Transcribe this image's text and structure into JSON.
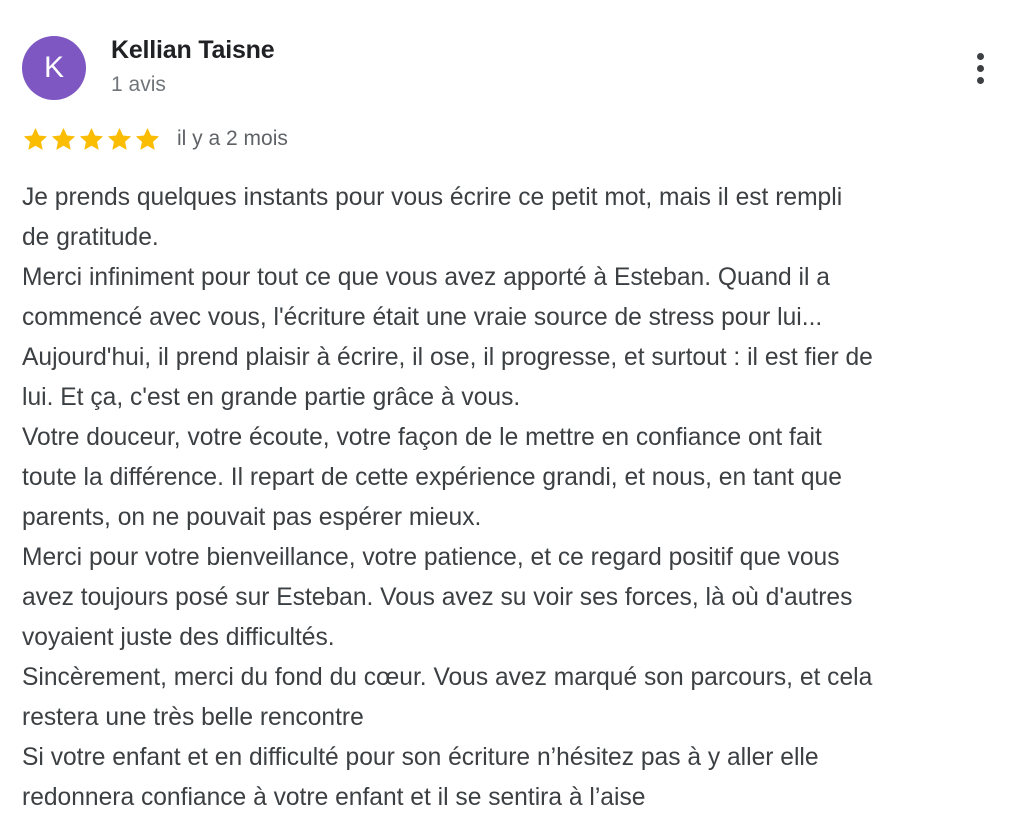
{
  "author": {
    "initial": "K",
    "name": "Kellian Taisne",
    "meta": "1 avis",
    "avatar_color": "#7e57c2"
  },
  "rating": {
    "stars": 5,
    "max": 5,
    "star_color": "#fbbc04",
    "time": "il y a 2 mois"
  },
  "menu_icon": "more-vert-icon",
  "review_lines": [
    "Je prends quelques instants pour vous écrire ce petit mot, mais il est rempli",
    "de gratitude.",
    "Merci infiniment pour tout ce que vous avez apporté à Esteban. Quand il a",
    "commencé avec vous, l'écriture était une vraie source de stress pour lui...",
    "Aujourd'hui, il prend plaisir à écrire, il ose, il progresse, et surtout : il est fier de",
    "lui. Et ça, c'est en grande partie grâce à vous.",
    "Votre douceur, votre écoute, votre façon de le mettre en confiance ont fait",
    "toute la différence. Il repart de cette expérience grandi, et nous, en tant que",
    "parents, on ne pouvait pas espérer mieux.",
    "Merci pour votre bienveillance, votre patience, et ce regard positif que vous",
    "avez toujours posé sur Esteban. Vous avez su voir ses forces, là où d'autres",
    "voyaient juste des difficultés.",
    "Sincèrement, merci du fond du cœur. Vous avez marqué son parcours, et cela",
    "restera une très belle rencontre",
    "Si votre enfant et en difficulté pour son écriture n’hésitez pas à y aller elle",
    "redonnera confiance à votre enfant et il se sentira à l’aise"
  ]
}
